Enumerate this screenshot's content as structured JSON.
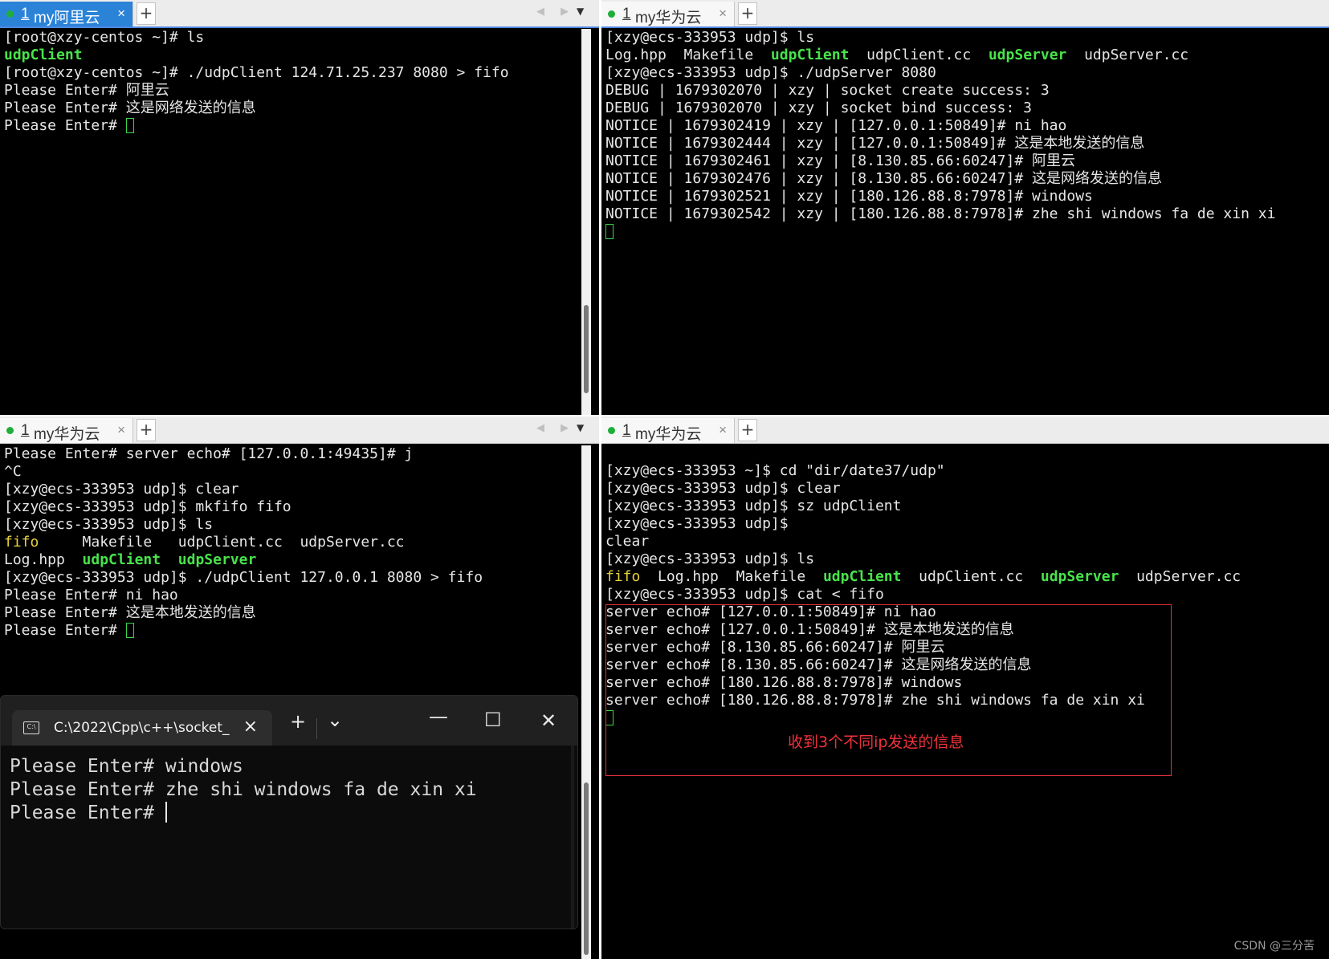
{
  "panes": {
    "top_left": {
      "tab": {
        "num": "1",
        "name": "my阿里云"
      },
      "lines": [
        [
          {
            "t": "[root@xzy-centos ~]# ls",
            "c": ""
          }
        ],
        [
          {
            "t": "udpClient",
            "c": "g"
          }
        ],
        [
          {
            "t": "[root@xzy-centos ~]# ./udpClient 124.71.25.237 8080 > fifo",
            "c": ""
          }
        ],
        [
          {
            "t": "Please Enter# 阿里云",
            "c": ""
          }
        ],
        [
          {
            "t": "Please Enter# 这是网络发送的信息",
            "c": ""
          }
        ],
        [
          {
            "t": "Please Enter# ",
            "c": ""
          },
          {
            "cursor": true
          }
        ]
      ]
    },
    "top_right": {
      "tab": {
        "num": "1",
        "name": "my华为云"
      },
      "lines": [
        [
          {
            "t": "[xzy@ecs-333953 udp]$ ls",
            "c": ""
          }
        ],
        [
          {
            "t": "Log.hpp  Makefile  ",
            "c": ""
          },
          {
            "t": "udpClient",
            "c": "g"
          },
          {
            "t": "  udpClient.cc  ",
            "c": ""
          },
          {
            "t": "udpServer",
            "c": "g"
          },
          {
            "t": "  udpServer.cc",
            "c": ""
          }
        ],
        [
          {
            "t": "[xzy@ecs-333953 udp]$ ./udpServer 8080",
            "c": ""
          }
        ],
        [
          {
            "t": "DEBUG | 1679302070 | xzy | socket create success: 3",
            "c": ""
          }
        ],
        [
          {
            "t": "DEBUG | 1679302070 | xzy | socket bind success: 3",
            "c": ""
          }
        ],
        [
          {
            "t": "NOTICE | 1679302419 | xzy | [127.0.0.1:50849]# ni hao",
            "c": ""
          }
        ],
        [
          {
            "t": "NOTICE | 1679302444 | xzy | [127.0.0.1:50849]# 这是本地发送的信息",
            "c": ""
          }
        ],
        [
          {
            "t": "NOTICE | 1679302461 | xzy | [8.130.85.66:60247]# 阿里云",
            "c": ""
          }
        ],
        [
          {
            "t": "NOTICE | 1679302476 | xzy | [8.130.85.66:60247]# 这是网络发送的信息",
            "c": ""
          }
        ],
        [
          {
            "t": "NOTICE | 1679302521 | xzy | [180.126.88.8:7978]# windows",
            "c": ""
          }
        ],
        [
          {
            "t": "NOTICE | 1679302542 | xzy | [180.126.88.8:7978]# zhe shi windows fa de xin xi",
            "c": ""
          }
        ],
        [
          {
            "cursor": true
          }
        ]
      ]
    },
    "bottom_left": {
      "tab": {
        "num": "1",
        "name": "my华为云"
      },
      "lines": [
        [
          {
            "t": "Please Enter# server echo# [127.0.0.1:49435]# j",
            "c": ""
          }
        ],
        [
          {
            "t": "^C",
            "c": ""
          }
        ],
        [
          {
            "t": "[xzy@ecs-333953 udp]$ clear",
            "c": ""
          }
        ],
        [
          {
            "t": "[xzy@ecs-333953 udp]$ mkfifo fifo",
            "c": ""
          }
        ],
        [
          {
            "t": "[xzy@ecs-333953 udp]$ ls",
            "c": ""
          }
        ],
        [
          {
            "t": "fifo",
            "c": "y"
          },
          {
            "t": "     Makefile   udpClient.cc  udpServer.cc",
            "c": ""
          }
        ],
        [
          {
            "t": "Log.hpp  ",
            "c": ""
          },
          {
            "t": "udpClient",
            "c": "g"
          },
          {
            "t": "  ",
            "c": ""
          },
          {
            "t": "udpServer",
            "c": "g"
          }
        ],
        [
          {
            "t": "[xzy@ecs-333953 udp]$ ./udpClient 127.0.0.1 8080 > fifo",
            "c": ""
          }
        ],
        [
          {
            "t": "Please Enter# ni hao",
            "c": ""
          }
        ],
        [
          {
            "t": "Please Enter# 这是本地发送的信息",
            "c": ""
          }
        ],
        [
          {
            "t": "Please Enter# ",
            "c": ""
          },
          {
            "cursor": true
          }
        ]
      ]
    },
    "bottom_right": {
      "tab": {
        "num": "1",
        "name": "my华为云"
      },
      "lines": [
        [
          {
            "t": "[xzy@ecs-333953 ~]$ cd \"dir/date37/udp\"",
            "c": ""
          }
        ],
        [
          {
            "t": "[xzy@ecs-333953 udp]$ clear",
            "c": ""
          }
        ],
        [
          {
            "t": "[xzy@ecs-333953 udp]$ sz udpClient",
            "c": ""
          }
        ],
        [
          {
            "t": "[xzy@ecs-333953 udp]$",
            "c": ""
          }
        ],
        [
          {
            "t": "clear",
            "c": ""
          }
        ],
        [
          {
            "t": "[xzy@ecs-333953 udp]$ ls",
            "c": ""
          }
        ],
        [
          {
            "t": "fifo",
            "c": "y"
          },
          {
            "t": "  Log.hpp  Makefile  ",
            "c": ""
          },
          {
            "t": "udpClient",
            "c": "g"
          },
          {
            "t": "  udpClient.cc  ",
            "c": ""
          },
          {
            "t": "udpServer",
            "c": "g"
          },
          {
            "t": "  udpServer.cc",
            "c": ""
          }
        ],
        [
          {
            "t": "[xzy@ecs-333953 udp]$ cat < fifo",
            "c": ""
          }
        ],
        [
          {
            "t": "server echo# [127.0.0.1:50849]# ni hao",
            "c": ""
          }
        ],
        [
          {
            "t": "server echo# [127.0.0.1:50849]# 这是本地发送的信息",
            "c": ""
          }
        ],
        [
          {
            "t": "server echo# [8.130.85.66:60247]# 阿里云",
            "c": ""
          }
        ],
        [
          {
            "t": "server echo# [8.130.85.66:60247]# 这是网络发送的信息",
            "c": ""
          }
        ],
        [
          {
            "t": "server echo# [180.126.88.8:7978]# windows",
            "c": ""
          }
        ],
        [
          {
            "t": "server echo# [180.126.88.8:7978]# zhe shi windows fa de xin xi",
            "c": ""
          }
        ],
        [
          {
            "cursor": true
          }
        ]
      ],
      "annotation": "收到3个不同ip发送的信息"
    }
  },
  "windows_terminal": {
    "tab_icon": "C:\\",
    "tab_title": "C:\\2022\\Cpp\\c++\\socket_",
    "lines": [
      "Please Enter# windows",
      "Please Enter# zhe shi windows fa de xin xi",
      "Please Enter# "
    ]
  },
  "icons": {
    "tab_close": "×",
    "add_tab": "+",
    "nav_arrows": "◀ ▶",
    "dropdown": "▼",
    "wt_add": "+",
    "wt_dropdown": "⌄",
    "wt_minimize": "—",
    "wt_maximize": "☐",
    "wt_close": "✕"
  },
  "watermark": "CSDN @三分苦",
  "colors": {
    "active_tab": "#2b83d8",
    "status_dot": "#1fae3a",
    "highlight_green": "#48e34b",
    "highlight_yellow": "#e8d23a",
    "annotation_red": "#f0323a"
  }
}
